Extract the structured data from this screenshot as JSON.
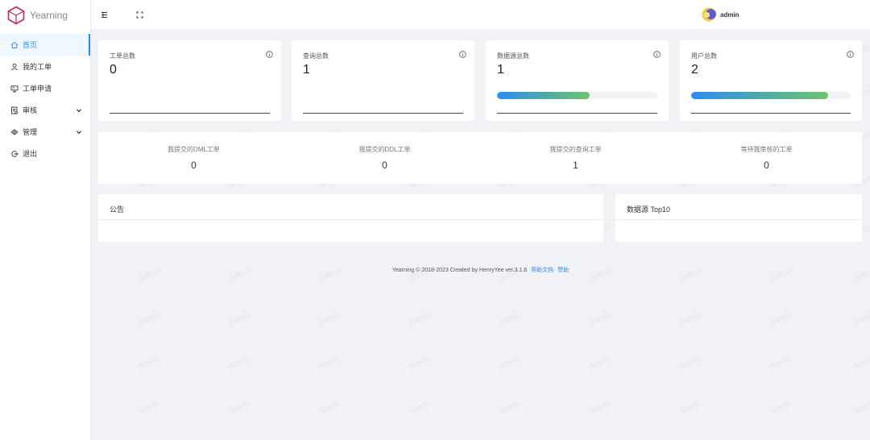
{
  "app": {
    "name": "Yearning"
  },
  "sidebar": {
    "items": [
      {
        "label": "首页",
        "icon": "home-icon",
        "active": true,
        "expandable": false
      },
      {
        "label": "我的工单",
        "icon": "user-icon",
        "active": false,
        "expandable": false
      },
      {
        "label": "工单申请",
        "icon": "monitor-icon",
        "active": false,
        "expandable": false
      },
      {
        "label": "审核",
        "icon": "audit-icon",
        "active": false,
        "expandable": true
      },
      {
        "label": "管理",
        "icon": "settings-icon",
        "active": false,
        "expandable": true
      },
      {
        "label": "退出",
        "icon": "logout-icon",
        "active": false,
        "expandable": false
      }
    ]
  },
  "header": {
    "username": "admin"
  },
  "stats": [
    {
      "title": "工单总数",
      "value": "0"
    },
    {
      "title": "查询总数",
      "value": "1"
    },
    {
      "title": "数据源总数",
      "value": "1",
      "progress": 0.58
    },
    {
      "title": "用户总数",
      "value": "2",
      "progress": 0.86
    }
  ],
  "summary": [
    {
      "label": "我提交的DML工单",
      "value": "0"
    },
    {
      "label": "我提交的DDL工单",
      "value": "0"
    },
    {
      "label": "我提交的查询工单",
      "value": "1"
    },
    {
      "label": "等待我审核的工单",
      "value": "0"
    }
  ],
  "panels": {
    "notice_title": "公告",
    "top10_title": "数据源 Top10"
  },
  "footer": {
    "text": "Yearning © 2018-2023 Created by HenryYee ver.3.1.6",
    "help_link": "帮助文档",
    "sponsor_link": "赞助"
  },
  "watermark": "admin",
  "colors": {
    "accent": "#2d8cf0",
    "progress_start": "#2d8cf0",
    "progress_end": "#6cc56c"
  }
}
